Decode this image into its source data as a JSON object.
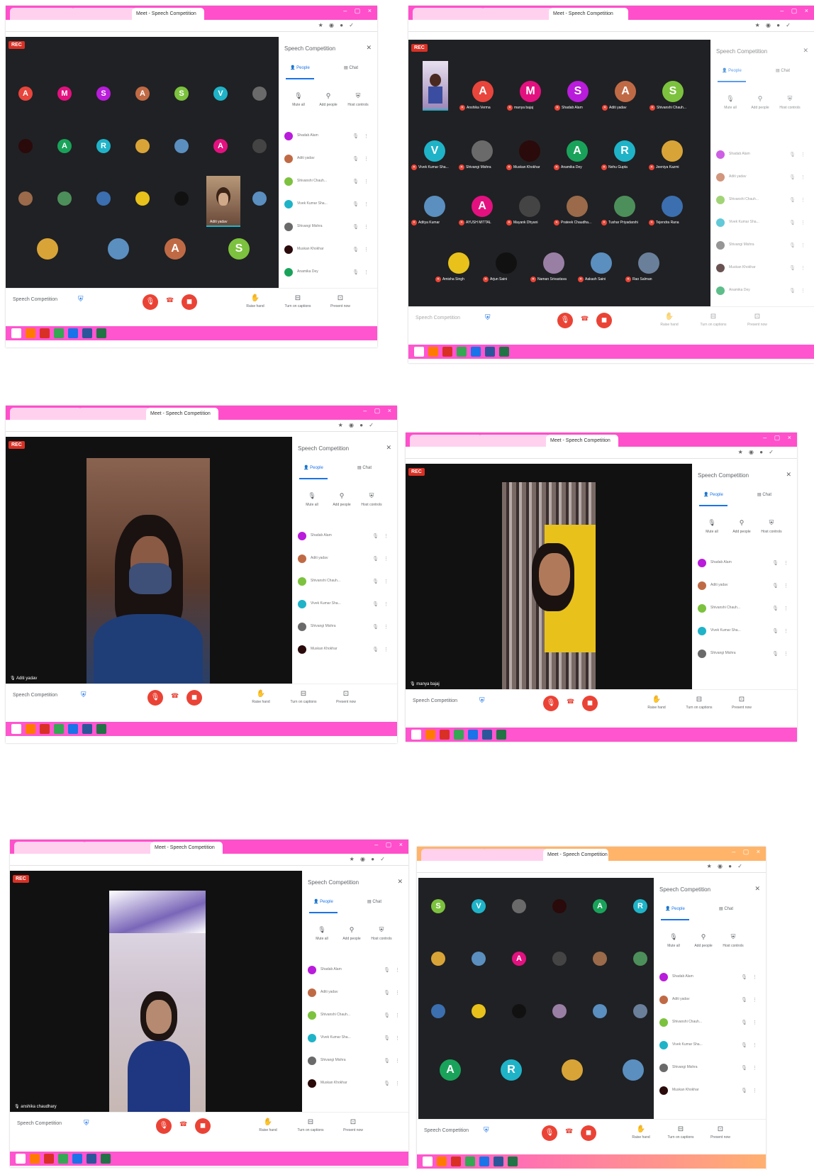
{
  "browser": {
    "tabs": [
      "Meet - Speech Competition"
    ],
    "window_controls": "– ▢ ×"
  },
  "meeting": {
    "title": "Speech Competition",
    "rec_label": "REC"
  },
  "panel": {
    "title": "Speech Competition",
    "people_tab": "People",
    "chat_tab": "Chat",
    "actions": [
      "Mute all",
      "Add people",
      "Host controls"
    ]
  },
  "participants": [
    {
      "initial": "A",
      "color": "#e8453c",
      "name": "Anshika Verma"
    },
    {
      "initial": "M",
      "color": "#e3117f",
      "name": "manya bajaj"
    },
    {
      "initial": "S",
      "color": "#b91cdb",
      "name": "Shadab Alam"
    },
    {
      "initial": "A",
      "color": "#c06a45",
      "name": "Aditi yadav"
    },
    {
      "initial": "S",
      "color": "#7cc23e",
      "name": "Shivanshi Chauh..."
    },
    {
      "initial": "V",
      "color": "#1fb3c8",
      "name": "Vivek Kumar Sha..."
    },
    {
      "initial": "",
      "color": "#6a6a6a",
      "name": "Shivangi Mishra"
    },
    {
      "initial": "",
      "color": "#2a0a0a",
      "name": "Muskan Khokhar"
    },
    {
      "initial": "A",
      "color": "#19a35a",
      "name": "Anamika Dey"
    },
    {
      "initial": "R",
      "color": "#1fb3c8",
      "name": "Nehu Gupta"
    },
    {
      "initial": "",
      "color": "#d9a437",
      "name": "Jeeniya Kazmi"
    },
    {
      "initial": "",
      "color": "#5a8fc0",
      "name": "Aditya Kumar"
    },
    {
      "initial": "A",
      "color": "#e3117f",
      "name": "AYUSH MITTAL"
    },
    {
      "initial": "",
      "color": "#444444",
      "name": "Mayank Dhyani"
    },
    {
      "initial": "",
      "color": "#9a6a4a",
      "name": "Prateek Chaudha..."
    },
    {
      "initial": "",
      "color": "#4d8f5a",
      "name": "Tushar Priyadarshi"
    },
    {
      "initial": "",
      "color": "#3b6fb0",
      "name": "Tejendra Rana"
    },
    {
      "initial": "",
      "color": "#e8c21b",
      "name": "Amisha Singh"
    },
    {
      "initial": "",
      "color": "#111111",
      "name": "Arjun Saini"
    },
    {
      "initial": "",
      "color": "#9a7fa5",
      "name": "Naman Srivastava"
    },
    {
      "initial": "",
      "color": "#5a8fc0",
      "name": "Aakash Saini"
    },
    {
      "initial": "",
      "color": "#6a7f9a",
      "name": "Rao Salman"
    }
  ],
  "captions": {
    "shot3": "Aditi yadav",
    "shot4": "manya bajaj",
    "shot5": "anshika chaudhary",
    "shot2_self": "anshika chaudhary",
    "shot1_self": "Aditi yadav"
  },
  "bottom": {
    "raise_hand": "Raise hand",
    "captions": "Turn on captions",
    "present": "Present now"
  },
  "colors": {
    "chrome": "#ff4fcb",
    "taskbar": "#ff55cf",
    "stage": "#202124",
    "red": "#ea4335",
    "blue": "#1a73e8"
  }
}
